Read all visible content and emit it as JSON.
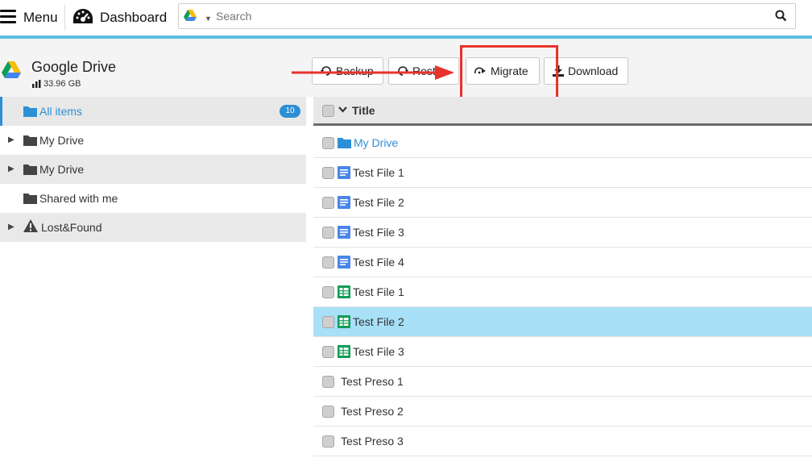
{
  "topbar": {
    "menu_label": "Menu",
    "dashboard_label": "Dashboard",
    "search": {
      "placeholder": "Search",
      "value": ""
    }
  },
  "source": {
    "title": "Google Drive",
    "storage": "33.96 GB"
  },
  "actions": {
    "backup": "Backup",
    "restore": "Resto",
    "migrate": "Migrate",
    "download": "Download"
  },
  "sidebar": {
    "items": [
      {
        "label": "All items",
        "count": "10",
        "icon": "folder-icon",
        "selected": true
      },
      {
        "label": "My Drive",
        "icon": "folder-icon",
        "expandable": true
      },
      {
        "label": "My Drive",
        "icon": "folder-icon",
        "expandable": true
      },
      {
        "label": "Shared with me",
        "icon": "folder-icon",
        "expandable": false
      },
      {
        "label": "Lost&Found",
        "icon": "warning-icon",
        "expandable": true
      }
    ]
  },
  "list": {
    "header": {
      "title": "Title"
    },
    "rows": [
      {
        "name": "My Drive",
        "type": "folder"
      },
      {
        "name": "Test File 1",
        "type": "doc"
      },
      {
        "name": "Test File 2",
        "type": "doc"
      },
      {
        "name": "Test File 3",
        "type": "doc"
      },
      {
        "name": "Test File 4",
        "type": "doc"
      },
      {
        "name": "Test File 1",
        "type": "sheet"
      },
      {
        "name": "Test File 2",
        "type": "sheet",
        "selected": true
      },
      {
        "name": "Test File 3",
        "type": "sheet"
      },
      {
        "name": "Test Preso 1",
        "type": "none"
      },
      {
        "name": "Test Preso 2",
        "type": "none"
      },
      {
        "name": "Test Preso 3",
        "type": "none"
      }
    ]
  },
  "colors": {
    "accent": "#5bc0de",
    "link": "#2d8fd5",
    "highlight": "#e8322c",
    "selected_row": "#a8e0f7"
  }
}
